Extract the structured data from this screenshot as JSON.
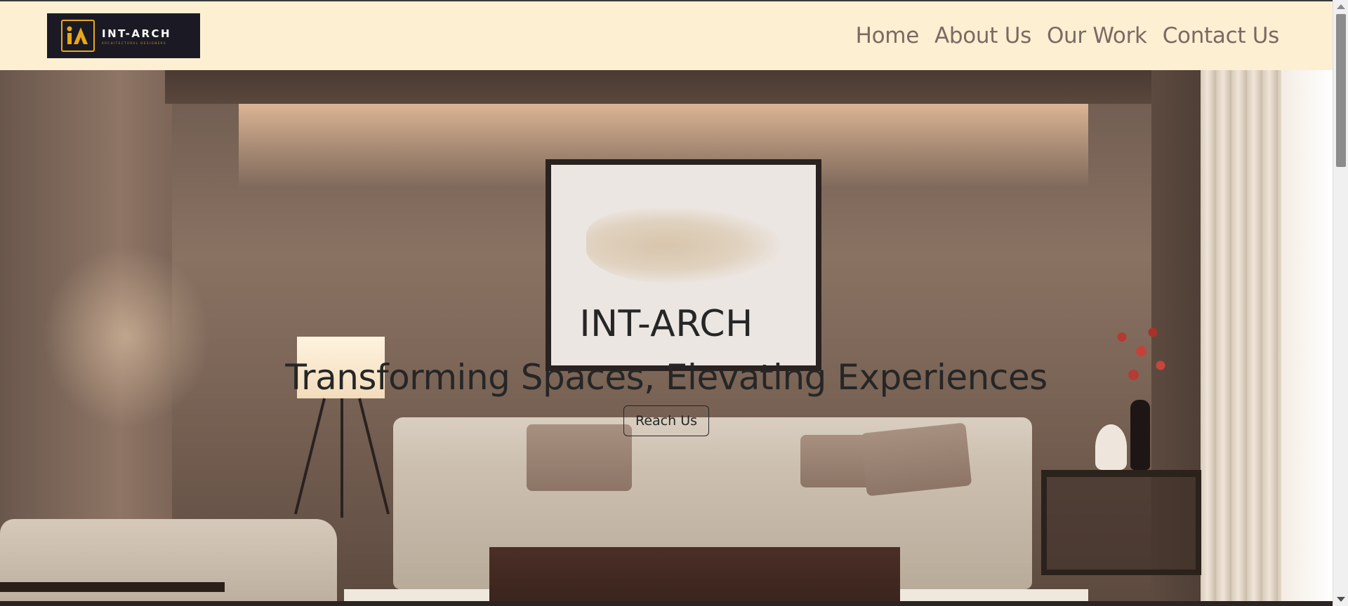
{
  "navbar": {
    "logo": {
      "name": "INT-ARCH",
      "tagline": "ARCHITECTURAL DESIGNERS",
      "mark_letters": "iA"
    },
    "links": [
      "Home",
      "About Us",
      "Our Work",
      "Contact Us"
    ]
  },
  "hero": {
    "title": "INT-ARCH",
    "subtitle": "Transforming Spaces, Elevating Experiences",
    "button_label": "Reach Us"
  },
  "colors": {
    "navbar_bg": "#fdefd2",
    "nav_link": "#7a6a63",
    "logo_bg": "#1b1a24",
    "logo_accent": "#e8a818",
    "hero_text": "#262626"
  },
  "icons": {
    "logo_mark": "int-arch-logo-icon",
    "scroll_up": "triangle-up-icon",
    "scroll_down": "triangle-down-icon"
  }
}
